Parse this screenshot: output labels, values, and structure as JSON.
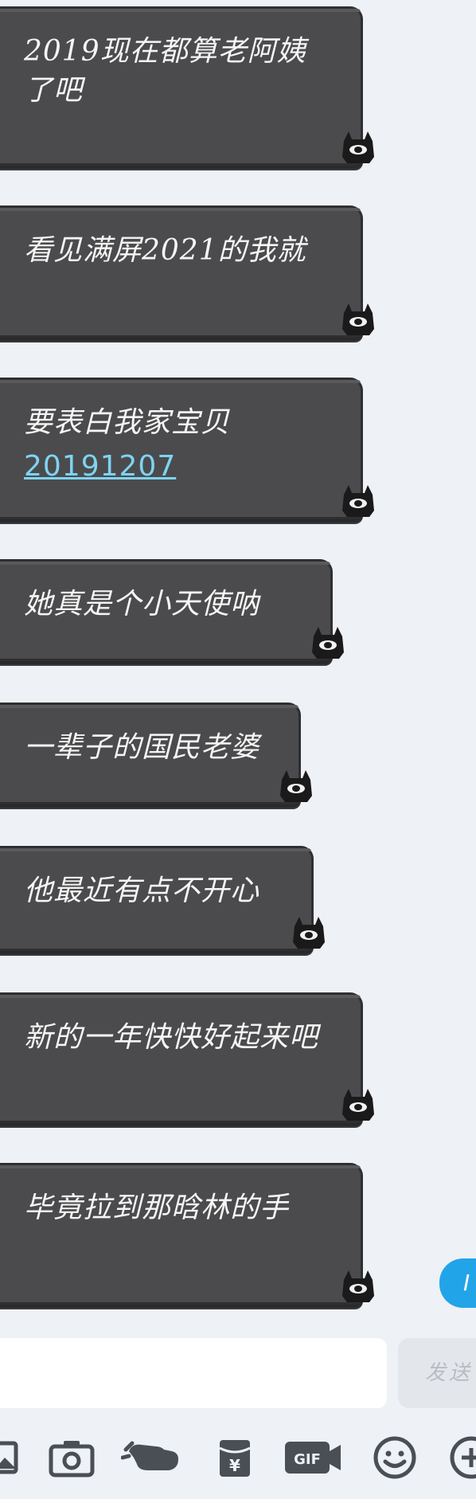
{
  "messages": [
    {
      "text": "2019现在都算老阿姨了吧"
    },
    {
      "text": "看见满屏2021的我就"
    },
    {
      "text": "要表白我家宝贝",
      "link": "20191207"
    },
    {
      "text": "她真是个小天使呐"
    },
    {
      "text": "一辈子的国民老婆"
    },
    {
      "text": "他最近有点不开心"
    },
    {
      "text": "新的一年快快好起来吧"
    },
    {
      "text": "毕竟拉到那晗林的手"
    }
  ],
  "sent_bubble": {
    "text": "I"
  },
  "input": {
    "value": "",
    "placeholder": ""
  },
  "send_button": {
    "label": "发送"
  },
  "toolbar": {
    "icons": [
      "image-icon",
      "camera-icon",
      "poke-hand-icon",
      "red-packet-icon",
      "gif-icon",
      "emoji-icon",
      "add-icon"
    ]
  },
  "colors": {
    "background": "#eef1f5",
    "bubble": "#4b4b4d",
    "link": "#7fd3f2",
    "sent_bubble": "#22a4e8",
    "send_button_bg": "#e3e6ea",
    "icon": "#4a4e55"
  }
}
